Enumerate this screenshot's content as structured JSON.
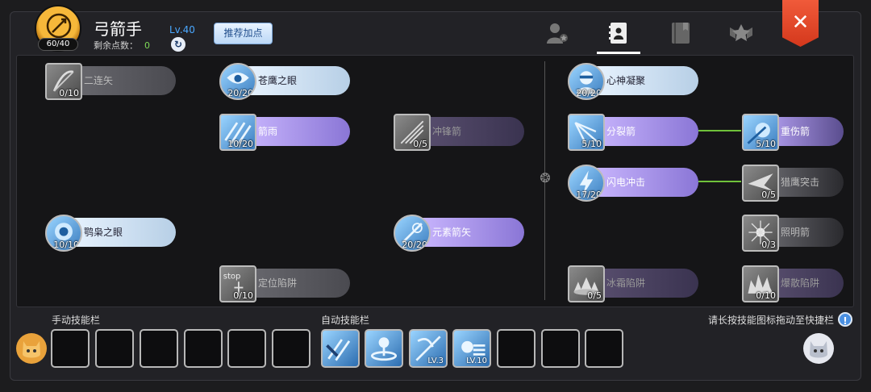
{
  "header": {
    "class_name": "弓箭手",
    "skill_points_badge": "60/40",
    "remaining_label": "剩余点数：",
    "remaining_value": "0",
    "level": "Lv.40",
    "recommend_button": "推荐加点",
    "close_icon": "close-icon",
    "tabs": [
      {
        "icon": "character-star-icon",
        "active": false
      },
      {
        "icon": "skill-book-icon",
        "active": true
      },
      {
        "icon": "journal-icon",
        "active": false
      },
      {
        "icon": "emblem-star-icon",
        "active": false
      }
    ]
  },
  "skills": [
    {
      "name": "二连矢",
      "level": "0/10",
      "state": "locked",
      "style": "gray"
    },
    {
      "name": "苍鹰之眼",
      "level": "20/20",
      "state": "active",
      "style": "blue"
    },
    {
      "name": "箭雨",
      "level": "10/20",
      "state": "active",
      "style": "purple"
    },
    {
      "name": "冲锋箭",
      "level": "0/5",
      "state": "locked",
      "style": "purple-dim"
    },
    {
      "name": "鹗枭之眼",
      "level": "10/10",
      "state": "active",
      "style": "blue"
    },
    {
      "name": "元素箭矢",
      "level": "20/20",
      "state": "active",
      "style": "purple"
    },
    {
      "name": "定位陷阱",
      "level": "0/10",
      "state": "locked",
      "style": "gray"
    },
    {
      "name": "心神凝聚",
      "level": "20/20",
      "state": "active",
      "style": "blue"
    },
    {
      "name": "分裂箭",
      "level": "5/10",
      "state": "active",
      "style": "purple"
    },
    {
      "name": "重伤箭",
      "level": "5/10",
      "state": "active",
      "style": "purple-fade"
    },
    {
      "name": "闪电冲击",
      "level": "17/20",
      "state": "active",
      "style": "purple"
    },
    {
      "name": "猎鹰突击",
      "level": "0/5",
      "state": "locked",
      "style": "fade"
    },
    {
      "name": "照明箭",
      "level": "0/3",
      "state": "locked",
      "style": "fade"
    },
    {
      "name": "冰霜陷阱",
      "level": "0/5",
      "state": "locked",
      "style": "purple-dim"
    },
    {
      "name": "爆散陷阱",
      "level": "0/10",
      "state": "locked",
      "style": "purple-dim"
    }
  ],
  "bottom": {
    "manual_label": "手动技能栏",
    "auto_label": "自动技能栏",
    "hint": "请长按技能图标拖动至快捷栏",
    "hint_icon_text": "!",
    "auto_slots": [
      {
        "icon": "arrow-rain-skill-icon",
        "level": ""
      },
      {
        "icon": "split-arrow-skill-icon",
        "level": ""
      },
      {
        "icon": "lightning-strike-skill-icon",
        "level": "LV.3"
      },
      {
        "icon": "eagle-eye-skill-icon",
        "level": "LV.10"
      }
    ]
  }
}
